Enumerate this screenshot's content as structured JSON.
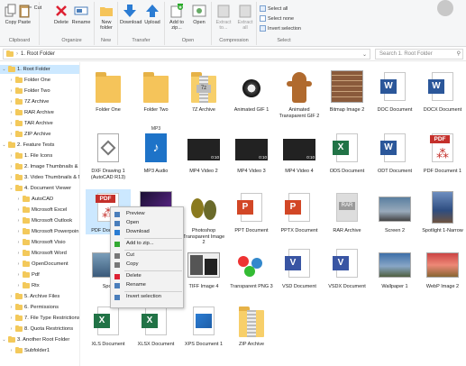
{
  "ribbon": {
    "groups": [
      {
        "label": "Clipboard",
        "buttons": [
          "Copy",
          "Paste"
        ],
        "small": [
          "Cut"
        ]
      },
      {
        "label": "Organize",
        "buttons": [
          "Delete",
          "Rename"
        ]
      },
      {
        "label": "New",
        "buttons": [
          "New folder"
        ]
      },
      {
        "label": "Transfer",
        "buttons": [
          "Download",
          "Upload"
        ]
      },
      {
        "label": "Open",
        "buttons": [
          "Add to zip...",
          "Open"
        ]
      },
      {
        "label": "Compression",
        "buttons": [
          "Extract to...",
          "Extract all"
        ]
      },
      {
        "label": "Select",
        "small": [
          "Select all",
          "Select none",
          "Invert selection"
        ]
      }
    ]
  },
  "address": {
    "path": "1. Root Folder",
    "search_placeholder": "Search 1. Root Folder"
  },
  "tree": [
    {
      "label": "1. Root Folder",
      "level": 0,
      "selected": true,
      "expanded": true
    },
    {
      "label": "Folder One",
      "level": 1
    },
    {
      "label": "Folder Two",
      "level": 1
    },
    {
      "label": "7Z Archive",
      "level": 1
    },
    {
      "label": "RAR Archive",
      "level": 1
    },
    {
      "label": "TAR Archive",
      "level": 1
    },
    {
      "label": "ZIP Archive",
      "level": 1
    },
    {
      "label": "2. Feature Tests",
      "level": 0,
      "expanded": true
    },
    {
      "label": "1. File Icons",
      "level": 1
    },
    {
      "label": "2. Image Thumbnails & I",
      "level": 1
    },
    {
      "label": "3. Video Thumbnails & M",
      "level": 1
    },
    {
      "label": "4. Document Viewer",
      "level": 1,
      "expanded": true
    },
    {
      "label": "AutoCAD",
      "level": 2
    },
    {
      "label": "Microsoft Excel",
      "level": 2
    },
    {
      "label": "Microsoft Outlook",
      "level": 2
    },
    {
      "label": "Microsoft Powerpoin",
      "level": 2
    },
    {
      "label": "Microsoft Visio",
      "level": 2
    },
    {
      "label": "Microsoft Word",
      "level": 2
    },
    {
      "label": "OpenDocument",
      "level": 2
    },
    {
      "label": "Pdf",
      "level": 2
    },
    {
      "label": "Rtx",
      "level": 2
    },
    {
      "label": "5. Archive Files",
      "level": 1
    },
    {
      "label": "6. Permissions",
      "level": 1
    },
    {
      "label": "7. File Type Restrictions",
      "level": 1
    },
    {
      "label": "8. Quota Restrictions",
      "level": 1
    },
    {
      "label": "3. Another Root Folder",
      "level": 0,
      "expanded": true
    },
    {
      "label": "Subfolder1",
      "level": 1
    }
  ],
  "files": [
    {
      "name": "Folder One",
      "kind": "folder"
    },
    {
      "name": "Folder Two",
      "kind": "folder"
    },
    {
      "name": "7Z Archive",
      "kind": "zip7"
    },
    {
      "name": "Animated GIF 1",
      "kind": "gif1"
    },
    {
      "name": "Animated Transparent GIF 2",
      "kind": "ginger"
    },
    {
      "name": "Bitmap Image 2",
      "kind": "brick"
    },
    {
      "name": "DOC Document",
      "kind": "word"
    },
    {
      "name": "DOCX Document",
      "kind": "word"
    },
    {
      "name": "DXF Drawing 1 (AutoCAD R13)",
      "kind": "dxf"
    },
    {
      "name": "MP3 Audio",
      "kind": "mp3"
    },
    {
      "name": "MP4 Video 2",
      "kind": "video",
      "time": "0:10"
    },
    {
      "name": "MP4 Video 3",
      "kind": "video",
      "time": "0:10"
    },
    {
      "name": "MP4 Video 4",
      "kind": "video",
      "time": "0:10"
    },
    {
      "name": "ODS Document",
      "kind": "excel"
    },
    {
      "name": "ODT Document",
      "kind": "word"
    },
    {
      "name": "PDF Document 1",
      "kind": "pdf"
    },
    {
      "name": "PDF Document",
      "kind": "pdf",
      "selected": true
    },
    {
      "name": "",
      "kind": "purple"
    },
    {
      "name": "Photoshop Transparent Image 2",
      "kind": "leaves"
    },
    {
      "name": "PPT Document",
      "kind": "ppt"
    },
    {
      "name": "PPTX Document",
      "kind": "ppt"
    },
    {
      "name": "RAR Archive",
      "kind": "rar"
    },
    {
      "name": "Screen 2",
      "kind": "screen"
    },
    {
      "name": "Spotlight 1-Narrow",
      "kind": "spot"
    },
    {
      "name": "Spotl",
      "kind": "spot2"
    },
    {
      "name": "",
      "kind": "blank"
    },
    {
      "name": "TIFF Image 4",
      "kind": "tiff"
    },
    {
      "name": "Transparent PNG 3",
      "kind": "png"
    },
    {
      "name": "VSD Document",
      "kind": "visio"
    },
    {
      "name": "VSDX Document",
      "kind": "visio"
    },
    {
      "name": "Wallpaper 1",
      "kind": "wall"
    },
    {
      "name": "WebP Image 2",
      "kind": "webp"
    },
    {
      "name": "XLS Document",
      "kind": "excel"
    },
    {
      "name": "XLSX Document",
      "kind": "excel"
    },
    {
      "name": "XPS Document 1",
      "kind": "xps"
    },
    {
      "name": "ZIP Archive",
      "kind": "zip"
    }
  ],
  "context_menu": [
    {
      "label": "Preview",
      "icon": "preview-icon"
    },
    {
      "label": "Open",
      "icon": "open-icon"
    },
    {
      "label": "Download",
      "icon": "download-icon"
    },
    {
      "sep": true
    },
    {
      "label": "Add to zip...",
      "icon": "zip-icon"
    },
    {
      "sep": true
    },
    {
      "label": "Cut",
      "icon": "cut-icon"
    },
    {
      "label": "Copy",
      "icon": "copy-icon"
    },
    {
      "sep": true
    },
    {
      "label": "Delete",
      "icon": "delete-icon"
    },
    {
      "label": "Rename",
      "icon": "rename-icon"
    },
    {
      "sep": true
    },
    {
      "label": "Invert selection",
      "icon": "invert-icon"
    }
  ],
  "colors": {
    "accent": "#2b7cd3",
    "selection": "#cce8ff",
    "folder": "#f5c45a",
    "word": "#2b579a",
    "excel": "#217346",
    "ppt": "#d24726",
    "pdf": "#c4302b",
    "visio": "#3955a3"
  }
}
